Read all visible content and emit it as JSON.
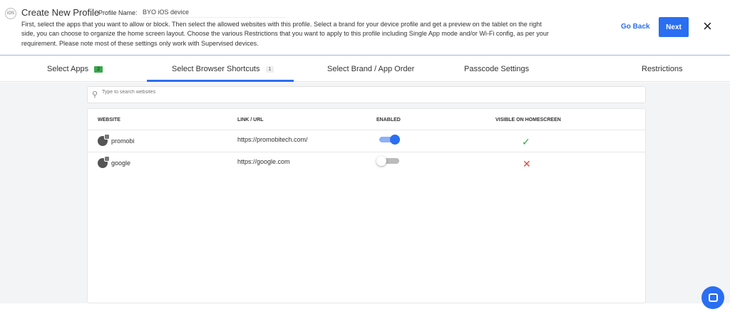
{
  "header": {
    "platform_badge": "iOS",
    "title": "Create New Profile",
    "profile_name_label": "Profile Name:",
    "profile_name_value": "BYO iOS device",
    "description": "First, select the apps that you want to allow or block. Then select the allowed websites with this profile. Select a brand for your device profile and get a preview on the tablet on the right side, you can choose to organize the home screen layout. Choose the various Restrictions that you want to apply to this profile including Single App mode and/or Wi-Fi config, as per your requirement. Please note most of these settings only work with Supervised devices.",
    "go_back_label": "Go Back",
    "next_label": "Next",
    "close_icon": "×"
  },
  "tabs": [
    {
      "label": "Select Apps",
      "badge": "2"
    },
    {
      "label": "Select Browser Shortcuts",
      "badge": "1",
      "active": true
    },
    {
      "label": "Select Brand / App Order"
    },
    {
      "label": "Passcode Settings"
    },
    {
      "label": "Restrictions"
    }
  ],
  "search": {
    "placeholder": "Type to search websites"
  },
  "table": {
    "headers": [
      "WEBSITE",
      "LINK / URL",
      "ENABLED",
      "VISIBLE ON HOMESCREEN"
    ],
    "rows": [
      {
        "website": "promobi",
        "url": "https://promobitech.com/",
        "enabled": true,
        "visible": "✓"
      },
      {
        "website": "google",
        "url": "https://google.com",
        "enabled": false,
        "visible": "✕"
      }
    ]
  },
  "colors": {
    "accent": "#2a6ef2",
    "check": "#3aa84a",
    "cross": "#e8453c"
  }
}
